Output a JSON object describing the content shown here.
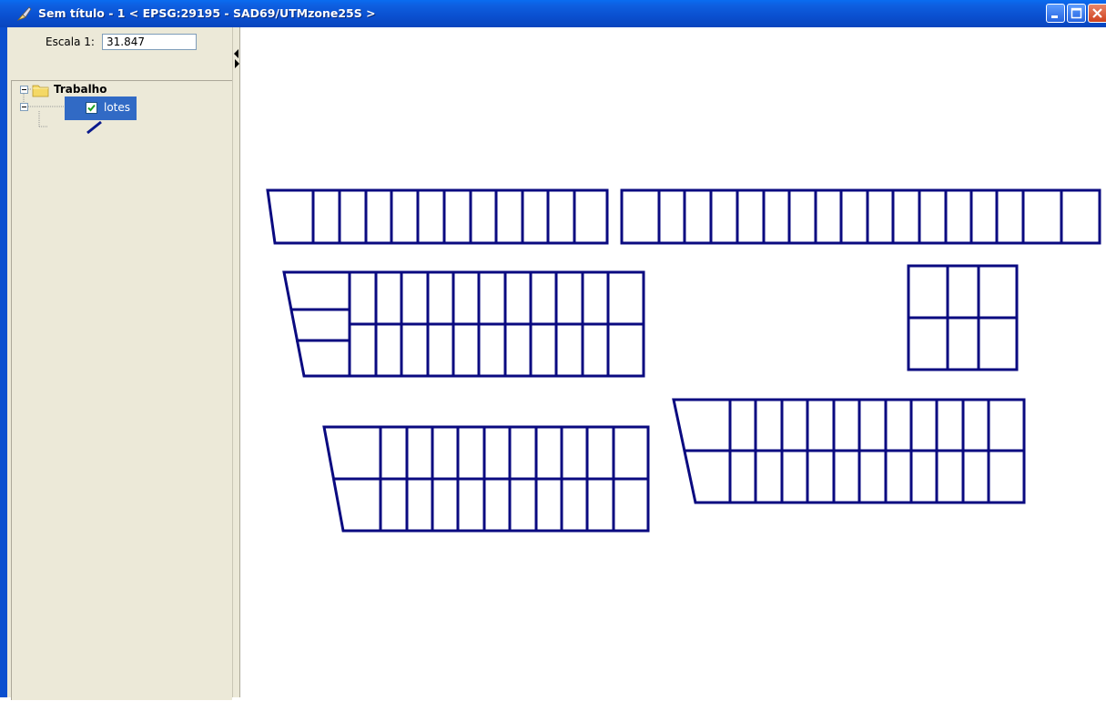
{
  "window": {
    "title": "Sem título - 1 < EPSG:29195 - SAD69/UTMzone25S >"
  },
  "scale": {
    "label": "Escala 1:",
    "value": "31.847"
  },
  "tree": {
    "root": {
      "label": "Trabalho",
      "icon": "folder-icon"
    },
    "layer": {
      "label": "lotes",
      "checked": true,
      "symbol_color": "#0a1a8c"
    }
  },
  "map": {
    "line_color": "#0a0a80",
    "background": "#ffffff"
  }
}
